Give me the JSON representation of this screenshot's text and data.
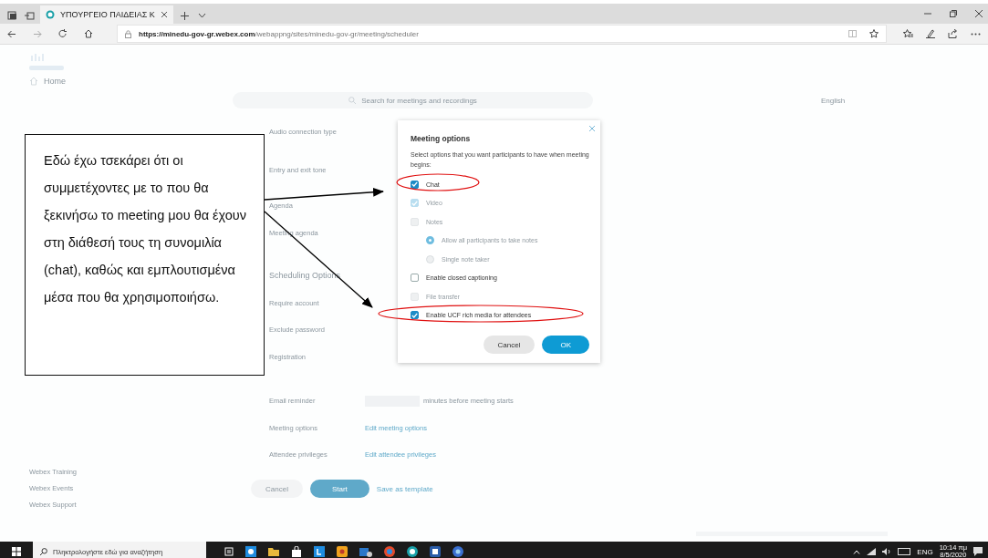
{
  "browser": {
    "tab_title": "ΥΠΟΥΡΓΕΙΟ ΠΑΙΔΕΙΑΣ Κ",
    "url_host": "https://minedu-gov-gr.webex.com",
    "url_path": "/webappng/sites/minedu-gov-gr/meeting/scheduler"
  },
  "page": {
    "sidebar": [
      {
        "label": "Home"
      }
    ],
    "sidebar_footer": [
      "Webex Training",
      "Webex Events",
      "Webex Support"
    ],
    "search_placeholder": "Search for meetings and recordings",
    "language": "English",
    "form": [
      {
        "label": "Audio connection type",
        "kind": "text"
      },
      {
        "label": "Entry and exit tone",
        "kind": "text"
      },
      {
        "label": "Agenda",
        "kind": "text"
      },
      {
        "label": "Meeting agenda",
        "kind": "text"
      },
      {
        "label": "Scheduling Options",
        "kind": "heading"
      },
      {
        "label": "Require account",
        "kind": "text"
      },
      {
        "label": "Exclude password",
        "kind": "text"
      },
      {
        "label": "Registration",
        "kind": "text"
      },
      {
        "label": "Email reminder",
        "kind": "number",
        "value": "minutes before meeting starts"
      },
      {
        "label": "Meeting options",
        "kind": "link",
        "value": "Edit meeting options"
      },
      {
        "label": "Attendee privileges",
        "kind": "link",
        "value": "Edit attendee privileges"
      }
    ],
    "actions": [
      {
        "label": "Cancel",
        "kind": "secondary"
      },
      {
        "label": "Start",
        "kind": "primary"
      },
      {
        "label": "Save as template",
        "kind": "link"
      }
    ]
  },
  "dialog": {
    "title": "Meeting options",
    "description": "Select options that you want participants to have when meeting begins:",
    "options": [
      {
        "label": "Chat",
        "kind": "checkbox",
        "checked": true,
        "disabled": false,
        "highlighted": true
      },
      {
        "label": "Video",
        "kind": "checkbox",
        "checked": true,
        "disabled": true,
        "highlighted": false
      },
      {
        "label": "Notes",
        "kind": "checkbox",
        "checked": false,
        "disabled": true,
        "highlighted": false
      },
      {
        "label": "Allow all participants to take notes",
        "kind": "radio",
        "selected": true,
        "disabled": true,
        "highlighted": false
      },
      {
        "label": "Single note taker",
        "kind": "radio",
        "selected": false,
        "disabled": true,
        "highlighted": false
      },
      {
        "label": "Enable closed captioning",
        "kind": "checkbox",
        "checked": false,
        "disabled": false,
        "highlighted": false
      },
      {
        "label": "File transfer",
        "kind": "checkbox",
        "checked": false,
        "disabled": true,
        "highlighted": false
      },
      {
        "label": "Enable UCF rich media for attendees",
        "kind": "checkbox",
        "checked": true,
        "disabled": false,
        "highlighted": true
      }
    ],
    "buttons": [
      {
        "label": "Cancel",
        "kind": "secondary"
      },
      {
        "label": "OK",
        "kind": "primary"
      }
    ]
  },
  "annotation": {
    "text": "Εδώ έχω τσεκάρει ότι οι συμμετέχοντες με το που θα ξεκινήσω το meeting μου θα έχουν στη διάθεσή τους τη συνομιλία (chat), καθώς και εμπλουτισμένα μέσα που θα χρησιμοποιήσω."
  },
  "taskbar": {
    "search_placeholder": "Πληκτρολογήστε εδώ για αναζήτηση",
    "language": "ENG",
    "time": "10:14 πμ",
    "date": "8/5/2020"
  }
}
